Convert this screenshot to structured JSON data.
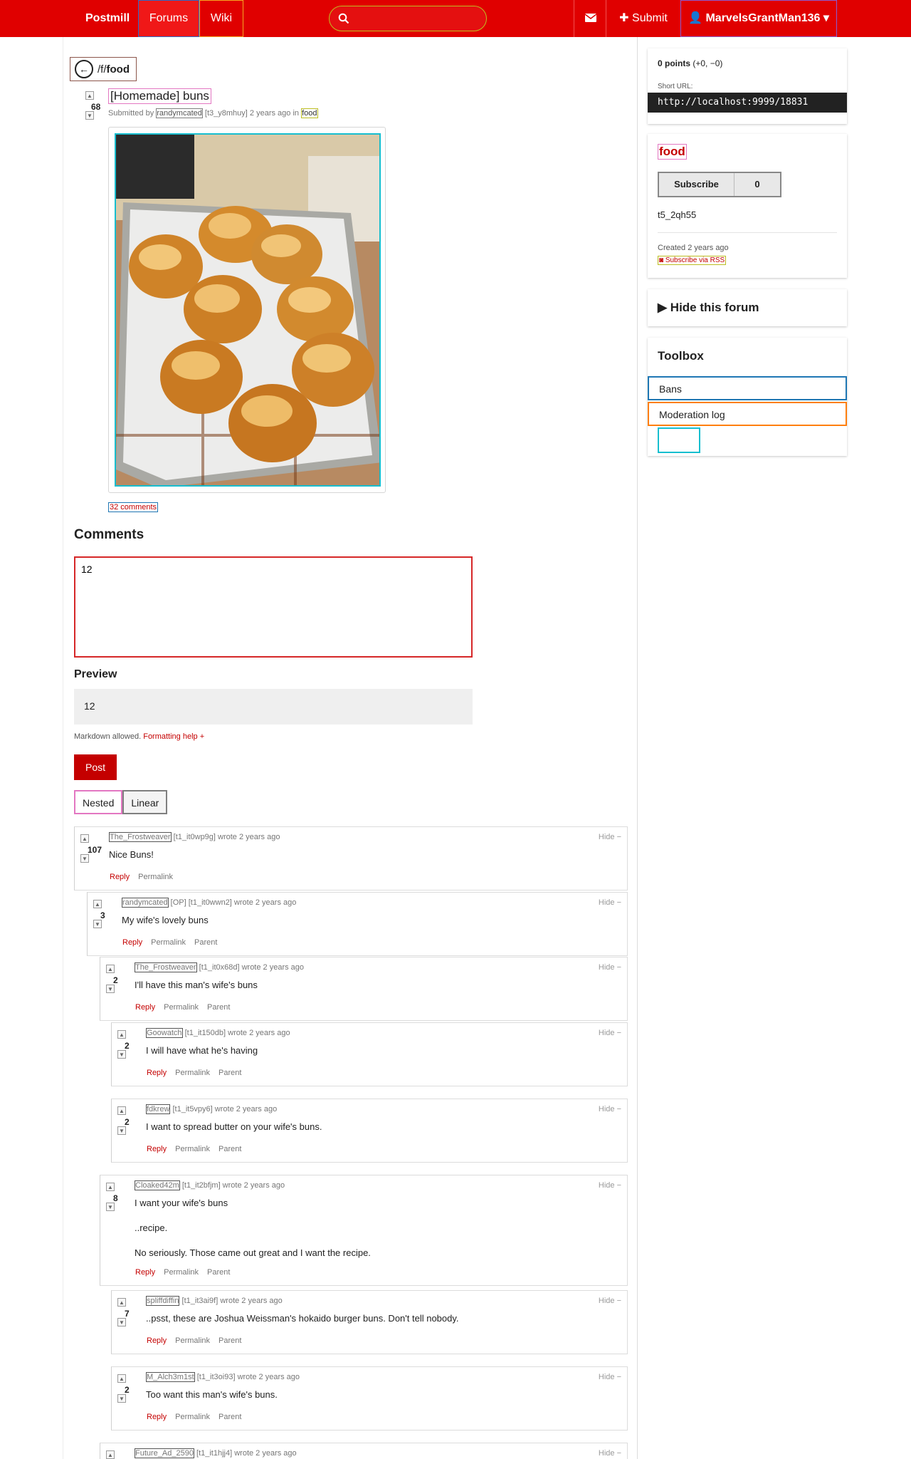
{
  "header": {
    "brand": "Postmill",
    "nav": {
      "forums": "Forums",
      "wiki": "Wiki"
    },
    "search_placeholder": "",
    "submit": "Submit",
    "user": "MarvelsGrantMan136 ▾"
  },
  "breadcrumb": {
    "prefix": "/f/",
    "forum": "food"
  },
  "post": {
    "score": "68",
    "title": "[Homemade] buns",
    "submitted_by": "Submitted by",
    "author": "randymcated",
    "author_id": "[t3_y8mhuy]",
    "time": "2 years ago in",
    "forum": "food",
    "comment_count_label": "32 comments"
  },
  "comment_form": {
    "heading": "Comments",
    "text": "12",
    "preview_heading": "Preview",
    "preview_text": "12",
    "markdown_note": "Markdown allowed.",
    "formatting_help": "Formatting help +",
    "post_label": "Post",
    "view_nested": "Nested",
    "view_linear": "Linear"
  },
  "comment_labels": {
    "reply": "Reply",
    "permalink": "Permalink",
    "parent": "Parent",
    "hide": "Hide −"
  },
  "comments": [
    {
      "author": "The_Frostweaver",
      "meta": "[t1_it0wp9g] wrote 2 years ago",
      "score": "107",
      "body": [
        "Nice Buns!"
      ]
    },
    {
      "author": "randymcated",
      "meta": "[OP] [t1_it0wwn2] wrote 2 years ago",
      "score": "3",
      "body": [
        "My wife's lovely buns"
      ]
    },
    {
      "author": "The_Frostweaver",
      "meta": "[t1_it0x68d] wrote 2 years ago",
      "score": "2",
      "body": [
        "I'll have this man's wife's buns"
      ]
    },
    {
      "author": "Goowatch",
      "meta": "[t1_it150db] wrote 2 years ago",
      "score": "2",
      "body": [
        "I will have what he's having"
      ]
    },
    {
      "author": "fdkrew",
      "meta": "[t1_it5vpy6] wrote 2 years ago",
      "score": "2",
      "body": [
        "I want to spread butter on your wife's buns."
      ]
    },
    {
      "author": "Cloaked42m",
      "meta": "[t1_it2bfjm] wrote 2 years ago",
      "score": "8",
      "body": [
        "I want your wife's buns",
        "..recipe.",
        "No seriously. Those came out great and I want the recipe."
      ]
    },
    {
      "author": "spliffdiffin",
      "meta": "[t1_it3ai9f] wrote 2 years ago",
      "score": "7",
      "body": [
        "..psst, these are Joshua Weissman's hokaido burger buns. Don't tell nobody."
      ]
    },
    {
      "author": "M_Alch3m1st",
      "meta": "[t1_it3oi93] wrote 2 years ago",
      "score": "2",
      "body": [
        "Too want this man's wife's buns."
      ]
    },
    {
      "author": "Future_Ad_2590",
      "meta": "[t1_it1hjj4] wrote 2 years ago",
      "score": "",
      "body": []
    }
  ],
  "sidebar": {
    "points_value": "0 points",
    "points_detail": "(+0, −0)",
    "short_url_label": "Short URL:",
    "short_url": "http://localhost:9999/18831",
    "forum_name": "food",
    "subscribe": "Subscribe",
    "subscribers": "0",
    "forum_id": "t5_2qh55",
    "created": "Created 2 years ago",
    "rss": "Subscribe via RSS",
    "hide_forum": "▶ Hide this forum",
    "toolbox_heading": "Toolbox",
    "bans": "Bans",
    "moderation_log": "Moderation log"
  },
  "colors": {
    "brand_red": "#e00000",
    "link_red": "#c40000"
  }
}
